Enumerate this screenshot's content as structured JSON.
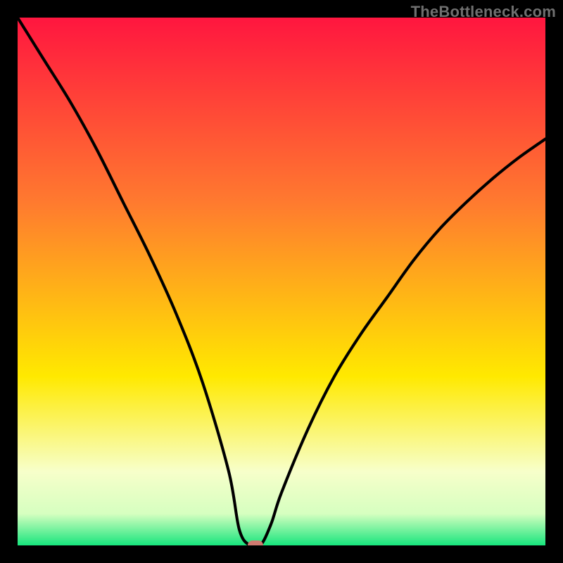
{
  "watermark": "TheBottleneck.com",
  "colors": {
    "frame": "#000000",
    "curve": "#000000",
    "watermark": "#6f6f6f",
    "marker": "#d07a70",
    "gradient_top": "#ff163f",
    "gradient_mid_upper": "#ff7a2f",
    "gradient_mid": "#ffe900",
    "gradient_lower": "#f4ffb0",
    "gradient_bottom": "#17e57d"
  },
  "chart_data": {
    "type": "line",
    "title": "",
    "xlabel": "",
    "ylabel": "",
    "xlim": [
      0,
      100
    ],
    "ylim": [
      0,
      100
    ],
    "grid": false,
    "legend": false,
    "annotations": [],
    "series": [
      {
        "name": "bottleneck-curve",
        "x": [
          0,
          5,
          10,
          15,
          20,
          25,
          30,
          35,
          40,
          42,
          44,
          46,
          48,
          50,
          55,
          60,
          65,
          70,
          75,
          80,
          85,
          90,
          95,
          100
        ],
        "values": [
          100,
          92,
          84,
          75,
          65,
          55,
          44,
          31,
          14,
          3,
          0,
          0,
          4,
          10,
          22,
          32,
          40,
          47,
          54,
          60,
          65,
          69.5,
          73.5,
          77
        ]
      }
    ],
    "marker": {
      "x": 45,
      "y": 0
    },
    "background_gradient_stops": [
      {
        "offset": 0.0,
        "color": "#ff163f"
      },
      {
        "offset": 0.35,
        "color": "#ff7a2f"
      },
      {
        "offset": 0.68,
        "color": "#ffe900"
      },
      {
        "offset": 0.86,
        "color": "#f7ffca"
      },
      {
        "offset": 0.94,
        "color": "#d6ffc0"
      },
      {
        "offset": 1.0,
        "color": "#17e57d"
      }
    ]
  }
}
